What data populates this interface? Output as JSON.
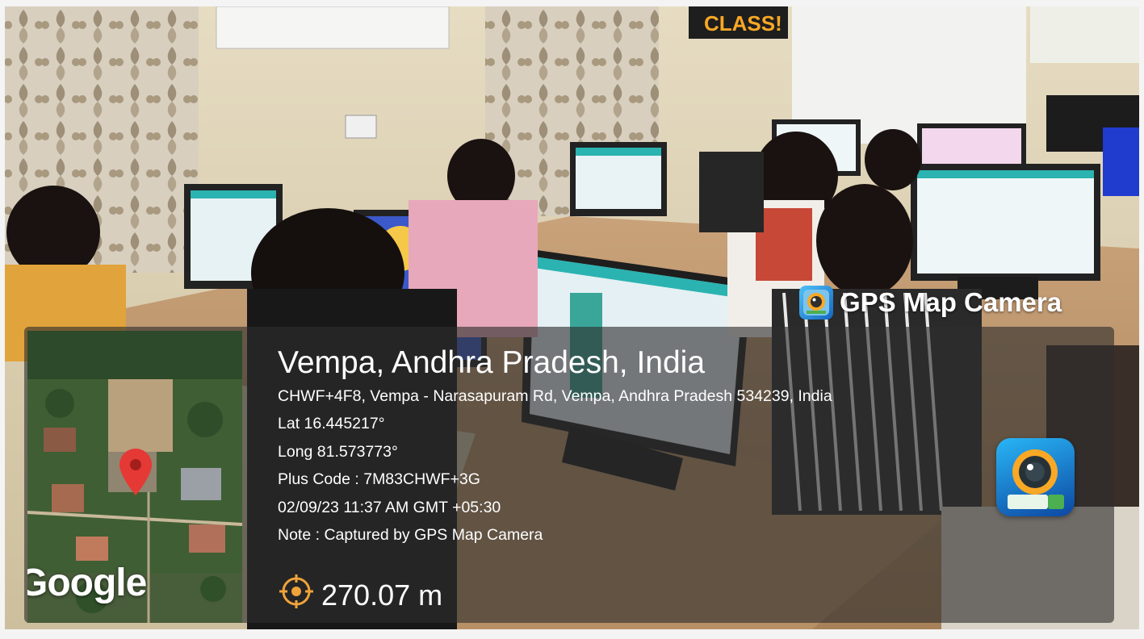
{
  "watermark": {
    "brand_label": "GPS Map Camera"
  },
  "location": {
    "title": "Vempa, Andhra Pradesh, India",
    "address": "CHWF+4F8, Vempa - Narasapuram Rd, Vempa, Andhra Pradesh 534239, India",
    "latitude": "Lat 16.445217°",
    "longitude": "Long 81.573773°",
    "plus_code": "Plus Code : 7M83CHWF+3G",
    "datetime": "02/09/23 11:37 AM GMT +05:30",
    "note": "Note : Captured by GPS Map Camera"
  },
  "map": {
    "provider": "Google",
    "pin_color": "#e53935"
  },
  "accuracy": {
    "value": "270.07 m"
  },
  "scene": {
    "sign_text": "CLASS!"
  },
  "icons": {
    "brand": "camera-lens-icon",
    "map_pin": "map-pin-icon",
    "accuracy": "target-icon",
    "app": "app-camera-icon"
  }
}
